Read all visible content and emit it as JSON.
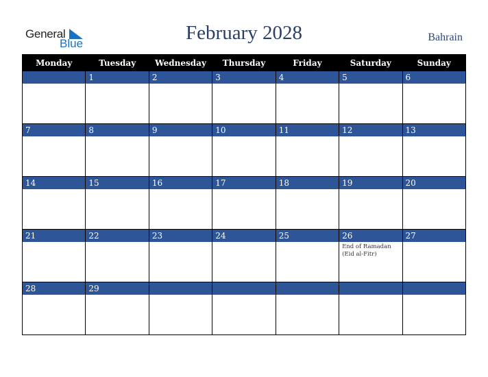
{
  "logo": {
    "line1": "General",
    "line2": "Blue"
  },
  "title": "February 2028",
  "country": "Bahrain",
  "colors": {
    "header_bg": "#000000",
    "day_bar": "#2e5597",
    "title": "#2b3e66",
    "logo_blue": "#1a73c0"
  },
  "weekdays": [
    "Monday",
    "Tuesday",
    "Wednesday",
    "Thursday",
    "Friday",
    "Saturday",
    "Sunday"
  ],
  "weeks": [
    [
      {
        "day": ""
      },
      {
        "day": "1"
      },
      {
        "day": "2"
      },
      {
        "day": "3"
      },
      {
        "day": "4"
      },
      {
        "day": "5"
      },
      {
        "day": "6"
      }
    ],
    [
      {
        "day": "7"
      },
      {
        "day": "8"
      },
      {
        "day": "9"
      },
      {
        "day": "10"
      },
      {
        "day": "11"
      },
      {
        "day": "12"
      },
      {
        "day": "13"
      }
    ],
    [
      {
        "day": "14"
      },
      {
        "day": "15"
      },
      {
        "day": "16"
      },
      {
        "day": "17"
      },
      {
        "day": "18"
      },
      {
        "day": "19"
      },
      {
        "day": "20"
      }
    ],
    [
      {
        "day": "21"
      },
      {
        "day": "22"
      },
      {
        "day": "23"
      },
      {
        "day": "24"
      },
      {
        "day": "25"
      },
      {
        "day": "26",
        "event": "End of Ramadan (Eid al-Fitr)"
      },
      {
        "day": "27"
      }
    ],
    [
      {
        "day": "28"
      },
      {
        "day": "29"
      },
      {
        "day": ""
      },
      {
        "day": ""
      },
      {
        "day": ""
      },
      {
        "day": ""
      },
      {
        "day": ""
      }
    ]
  ]
}
